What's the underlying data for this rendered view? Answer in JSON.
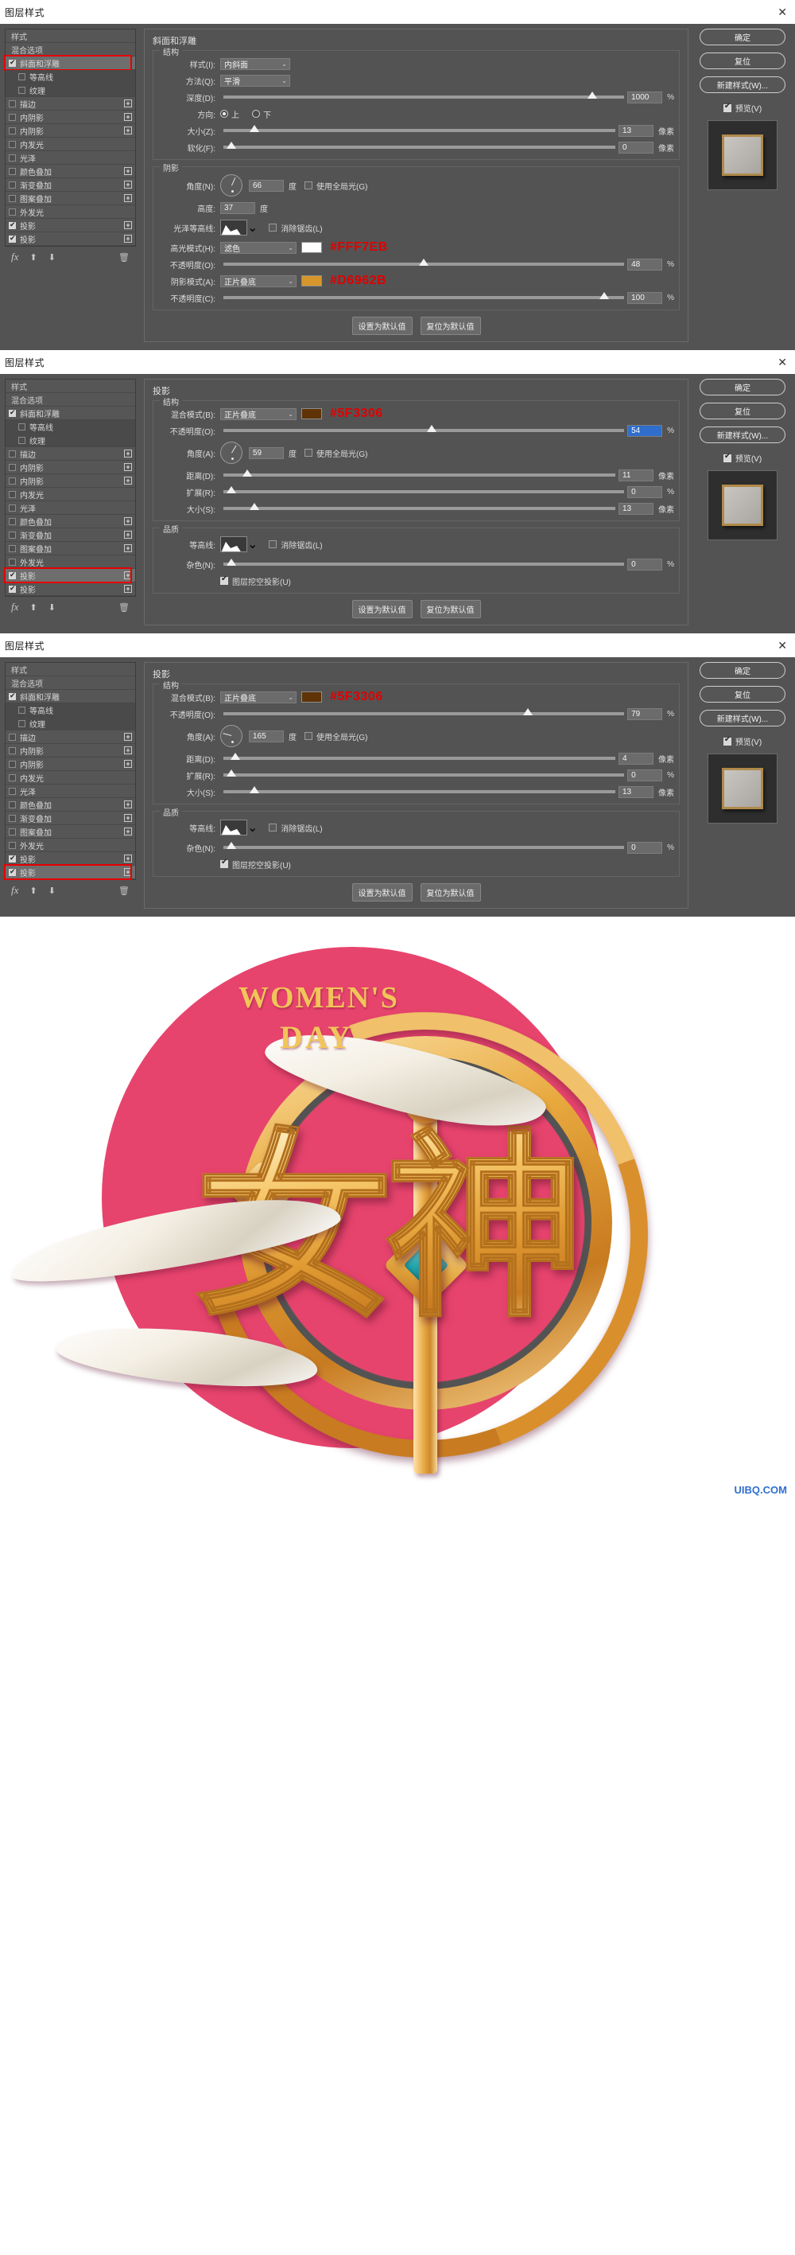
{
  "dialogs": [
    {
      "title": "图层样式",
      "close_label": "✕",
      "effects": [
        {
          "label": "样式",
          "type": "header"
        },
        {
          "label": "混合选项",
          "type": "header"
        },
        {
          "label": "斜面和浮雕",
          "checked": true,
          "selected": true,
          "highlight": true
        },
        {
          "label": "等高线",
          "checked": false,
          "sub": true
        },
        {
          "label": "纹理",
          "checked": false,
          "sub": true
        },
        {
          "label": "描边",
          "checked": false,
          "plus": true
        },
        {
          "label": "内阴影",
          "checked": false,
          "plus": true
        },
        {
          "label": "内阴影",
          "checked": false,
          "plus": true
        },
        {
          "label": "内发光",
          "checked": false
        },
        {
          "label": "光泽",
          "checked": false
        },
        {
          "label": "颜色叠加",
          "checked": false,
          "plus": true
        },
        {
          "label": "渐变叠加",
          "checked": false,
          "plus": true
        },
        {
          "label": "图案叠加",
          "checked": false,
          "plus": true
        },
        {
          "label": "外发光",
          "checked": false
        },
        {
          "label": "投影",
          "checked": true,
          "plus": true
        },
        {
          "label": "投影",
          "checked": true,
          "plus": true
        }
      ],
      "section_title": "斜面和浮雕",
      "groups": [
        {
          "title": "结构",
          "rows": [
            {
              "kind": "select",
              "label": "样式(I):",
              "value": "内斜面"
            },
            {
              "kind": "select",
              "label": "方法(Q):",
              "value": "平滑"
            },
            {
              "kind": "slider",
              "label": "深度(D):",
              "value": "1000",
              "unit": "%",
              "pos": 92
            },
            {
              "kind": "radio",
              "label": "方向:",
              "options": [
                "上",
                "下"
              ],
              "selected": 0
            },
            {
              "kind": "slider",
              "label": "大小(Z):",
              "value": "13",
              "unit": "像素",
              "pos": 8
            },
            {
              "kind": "slider",
              "label": "软化(F):",
              "value": "0",
              "unit": "像素",
              "pos": 2
            }
          ]
        },
        {
          "title": "阴影",
          "rows": [
            {
              "kind": "dial",
              "label": "角度(N):",
              "value": "66",
              "unit": "度",
              "check_label": "使用全局光(G)",
              "checked": false,
              "angle": 66
            },
            {
              "kind": "plain",
              "label": "高度:",
              "value": "37",
              "unit": "度"
            },
            {
              "kind": "contour",
              "label": "光泽等高线:",
              "check_label": "消除锯齿(L)",
              "checked": false
            },
            {
              "kind": "mode",
              "label": "高光模式(H):",
              "value": "滤色",
              "swatch": "#ffffff",
              "hex": "#FFF7EB"
            },
            {
              "kind": "slider",
              "label": "不透明度(O):",
              "value": "48",
              "unit": "%",
              "pos": 50
            },
            {
              "kind": "mode",
              "label": "阴影模式(A):",
              "value": "正片叠底",
              "swatch": "#d6962b",
              "hex": "#D6962B"
            },
            {
              "kind": "slider",
              "label": "不透明度(C):",
              "value": "100",
              "unit": "%",
              "pos": 95
            }
          ]
        }
      ],
      "footer_buttons": [
        "设置为默认值",
        "复位为默认值"
      ],
      "side_buttons": [
        "确定",
        "复位",
        "新建样式(W)..."
      ],
      "preview_label": "预览(V)",
      "preview_checked": true
    },
    {
      "title": "图层样式",
      "close_label": "✕",
      "effects": [
        {
          "label": "样式",
          "type": "header"
        },
        {
          "label": "混合选项",
          "type": "header"
        },
        {
          "label": "斜面和浮雕",
          "checked": true
        },
        {
          "label": "等高线",
          "checked": false,
          "sub": true
        },
        {
          "label": "纹理",
          "checked": false,
          "sub": true
        },
        {
          "label": "描边",
          "checked": false,
          "plus": true
        },
        {
          "label": "内阴影",
          "checked": false,
          "plus": true
        },
        {
          "label": "内阴影",
          "checked": false,
          "plus": true
        },
        {
          "label": "内发光",
          "checked": false
        },
        {
          "label": "光泽",
          "checked": false
        },
        {
          "label": "颜色叠加",
          "checked": false,
          "plus": true
        },
        {
          "label": "渐变叠加",
          "checked": false,
          "plus": true
        },
        {
          "label": "图案叠加",
          "checked": false,
          "plus": true
        },
        {
          "label": "外发光",
          "checked": false
        },
        {
          "label": "投影",
          "checked": true,
          "selected": true,
          "highlight": true,
          "plus": true
        },
        {
          "label": "投影",
          "checked": true,
          "plus": true
        }
      ],
      "section_title": "投影",
      "groups": [
        {
          "title": "结构",
          "rows": [
            {
              "kind": "mode",
              "label": "混合模式(B):",
              "value": "正片叠底",
              "swatch": "#5f3306",
              "hex": "#5F3306"
            },
            {
              "kind": "slider",
              "label": "不透明度(O):",
              "value": "54",
              "unit": "%",
              "pos": 52,
              "highlight": true
            },
            {
              "kind": "dial",
              "label": "角度(A):",
              "value": "59",
              "unit": "度",
              "check_label": "使用全局光(G)",
              "checked": false,
              "angle": 59
            },
            {
              "kind": "slider",
              "label": "距离(D):",
              "value": "11",
              "unit": "像素",
              "pos": 6
            },
            {
              "kind": "slider",
              "label": "扩展(R):",
              "value": "0",
              "unit": "%",
              "pos": 2
            },
            {
              "kind": "slider",
              "label": "大小(S):",
              "value": "13",
              "unit": "像素",
              "pos": 8
            }
          ]
        },
        {
          "title": "品质",
          "rows": [
            {
              "kind": "contour",
              "label": "等高线:",
              "check_label": "消除锯齿(L)",
              "checked": false
            },
            {
              "kind": "slider",
              "label": "杂色(N):",
              "value": "0",
              "unit": "%",
              "pos": 2
            },
            {
              "kind": "check",
              "check_label": "图层挖空投影(U)",
              "checked": true
            }
          ]
        }
      ],
      "footer_buttons": [
        "设置为默认值",
        "复位为默认值"
      ],
      "side_buttons": [
        "确定",
        "复位",
        "新建样式(W)..."
      ],
      "preview_label": "预览(V)",
      "preview_checked": true
    },
    {
      "title": "图层样式",
      "close_label": "✕",
      "effects": [
        {
          "label": "样式",
          "type": "header"
        },
        {
          "label": "混合选项",
          "type": "header"
        },
        {
          "label": "斜面和浮雕",
          "checked": true
        },
        {
          "label": "等高线",
          "checked": false,
          "sub": true
        },
        {
          "label": "纹理",
          "checked": false,
          "sub": true
        },
        {
          "label": "描边",
          "checked": false,
          "plus": true
        },
        {
          "label": "内阴影",
          "checked": false,
          "plus": true
        },
        {
          "label": "内阴影",
          "checked": false,
          "plus": true
        },
        {
          "label": "内发光",
          "checked": false
        },
        {
          "label": "光泽",
          "checked": false
        },
        {
          "label": "颜色叠加",
          "checked": false,
          "plus": true
        },
        {
          "label": "渐变叠加",
          "checked": false,
          "plus": true
        },
        {
          "label": "图案叠加",
          "checked": false,
          "plus": true
        },
        {
          "label": "外发光",
          "checked": false
        },
        {
          "label": "投影",
          "checked": true,
          "plus": true
        },
        {
          "label": "投影",
          "checked": true,
          "selected": true,
          "highlight": true,
          "plus": true
        }
      ],
      "section_title": "投影",
      "groups": [
        {
          "title": "结构",
          "rows": [
            {
              "kind": "mode",
              "label": "混合模式(B):",
              "value": "正片叠底",
              "swatch": "#5f3306",
              "hex": "#5F3306"
            },
            {
              "kind": "slider",
              "label": "不透明度(O):",
              "value": "79",
              "unit": "%",
              "pos": 76
            },
            {
              "kind": "dial",
              "label": "角度(A):",
              "value": "165",
              "unit": "度",
              "check_label": "使用全局光(G)",
              "checked": false,
              "angle": 165
            },
            {
              "kind": "slider",
              "label": "距离(D):",
              "value": "4",
              "unit": "像素",
              "pos": 3
            },
            {
              "kind": "slider",
              "label": "扩展(R):",
              "value": "0",
              "unit": "%",
              "pos": 2
            },
            {
              "kind": "slider",
              "label": "大小(S):",
              "value": "13",
              "unit": "像素",
              "pos": 8
            }
          ]
        },
        {
          "title": "品质",
          "rows": [
            {
              "kind": "contour",
              "label": "等高线:",
              "check_label": "消除锯齿(L)",
              "checked": false
            },
            {
              "kind": "slider",
              "label": "杂色(N):",
              "value": "0",
              "unit": "%",
              "pos": 2
            },
            {
              "kind": "check",
              "check_label": "图层挖空投影(U)",
              "checked": true
            }
          ]
        }
      ],
      "footer_buttons": [
        "设置为默认值",
        "复位为默认值"
      ],
      "side_buttons": [
        "确定",
        "复位",
        "新建样式(W)..."
      ],
      "preview_label": "预览(V)",
      "preview_checked": true
    }
  ],
  "artwork": {
    "english_line1": "WOMEN'S",
    "english_line2": "DAY",
    "chinese": "女神",
    "circle_color": "#e7446d",
    "gold_color": "#e8a93e",
    "gem_color": "#22a7ae",
    "watermark": "UIBQ.COM"
  }
}
